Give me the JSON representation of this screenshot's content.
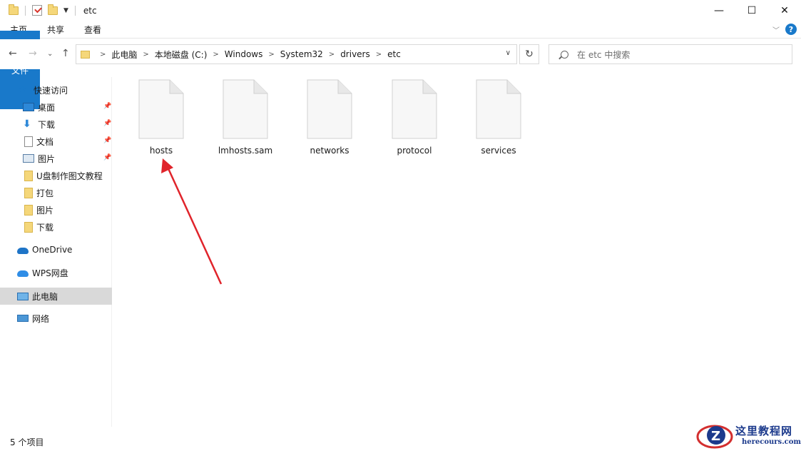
{
  "window": {
    "title": "etc",
    "controls": {
      "minimize": "—",
      "maximize": "☐",
      "close": "✕"
    }
  },
  "ribbon": {
    "tabs": [
      "文件",
      "主页",
      "共享",
      "查看"
    ],
    "help": "?"
  },
  "address": {
    "crumbs": [
      "此电脑",
      "本地磁盘 (C:)",
      "Windows",
      "System32",
      "drivers",
      "etc"
    ]
  },
  "search": {
    "placeholder": "在 etc 中搜索"
  },
  "sidebar": {
    "quick_access": "快速访问",
    "quick_items": [
      "桌面",
      "下载",
      "文档",
      "图片",
      "U盘制作图文教程",
      "打包",
      "图片",
      "下载"
    ],
    "onedrive": "OneDrive",
    "wps": "WPS网盘",
    "this_pc": "此电脑",
    "network": "网络"
  },
  "files": [
    "hosts",
    "lmhosts.sam",
    "networks",
    "protocol",
    "services"
  ],
  "status": {
    "count": "5 个项目"
  },
  "watermark": {
    "title": "这里教程网",
    "url": "herecours.com"
  },
  "colors": {
    "accent": "#1979ca",
    "annotation_arrow": "#e0242b",
    "selected_bg": "#d9d9d9"
  }
}
